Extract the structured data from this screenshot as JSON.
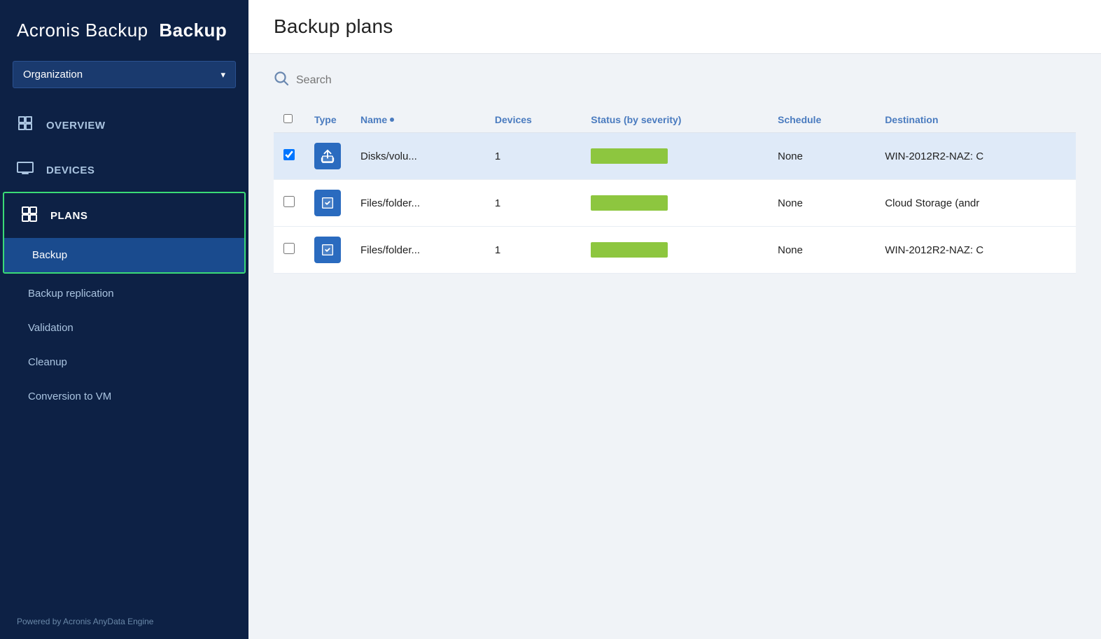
{
  "app": {
    "title": "Acronis Backup",
    "title_bold": "Backup",
    "footer": "Powered by Acronis AnyData Engine"
  },
  "org_selector": {
    "label": "Organization",
    "chevron": "▾"
  },
  "sidebar": {
    "nav": [
      {
        "id": "overview",
        "label": "OVERVIEW",
        "icon": "⊞"
      },
      {
        "id": "devices",
        "label": "DEVICES",
        "icon": "🖥"
      },
      {
        "id": "plans",
        "label": "PLANS",
        "icon": "⊟"
      }
    ],
    "plans_sub": [
      {
        "id": "backup",
        "label": "Backup",
        "active": true
      },
      {
        "id": "backup-replication",
        "label": "Backup replication",
        "active": false
      },
      {
        "id": "validation",
        "label": "Validation",
        "active": false
      },
      {
        "id": "cleanup",
        "label": "Cleanup",
        "active": false
      },
      {
        "id": "conversion-to-vm",
        "label": "Conversion to VM",
        "active": false
      }
    ]
  },
  "main": {
    "page_title": "Backup plans",
    "search_placeholder": "Search",
    "table": {
      "columns": [
        {
          "id": "checkbox",
          "label": ""
        },
        {
          "id": "type",
          "label": "Type"
        },
        {
          "id": "name",
          "label": "Name"
        },
        {
          "id": "devices",
          "label": "Devices"
        },
        {
          "id": "status",
          "label": "Status (by severity)"
        },
        {
          "id": "schedule",
          "label": "Schedule"
        },
        {
          "id": "destination",
          "label": "Destination"
        }
      ],
      "rows": [
        {
          "id": 1,
          "type_icon": "backup",
          "name": "Disks/volu...",
          "devices": "1",
          "status": "ok",
          "schedule": "None",
          "destination": "WIN-2012R2-NAZ: C",
          "selected": true
        },
        {
          "id": 2,
          "type_icon": "backup",
          "name": "Files/folder...",
          "devices": "1",
          "status": "ok",
          "schedule": "None",
          "destination": "Cloud Storage (andr"
        },
        {
          "id": 3,
          "type_icon": "backup",
          "name": "Files/folder...",
          "devices": "1",
          "status": "ok",
          "schedule": "None",
          "destination": "WIN-2012R2-NAZ: C"
        }
      ]
    }
  }
}
